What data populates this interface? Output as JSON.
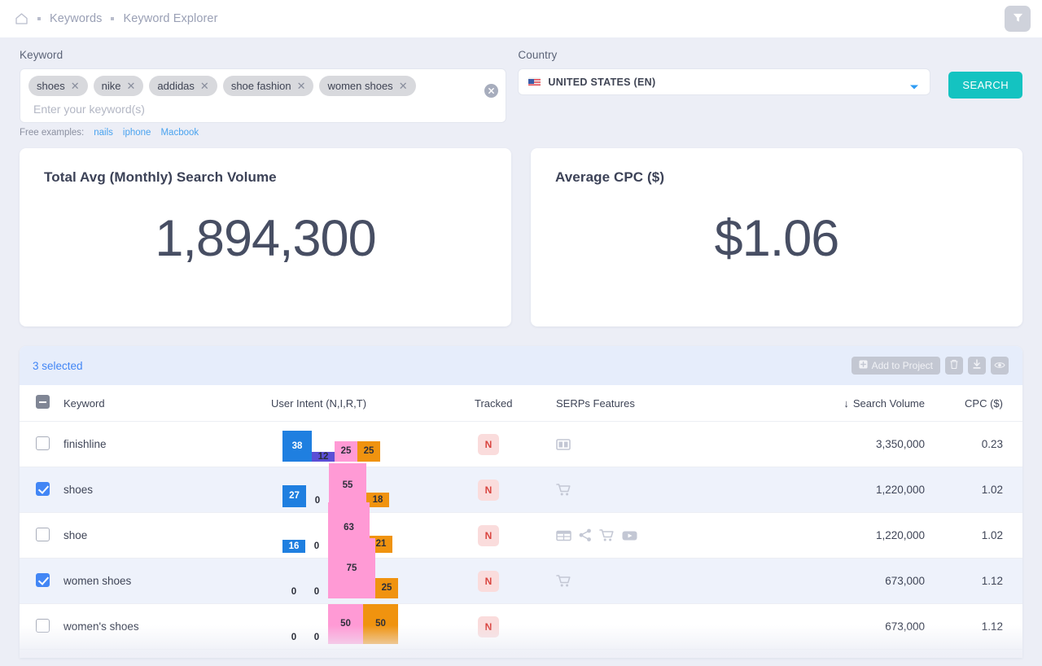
{
  "breadcrumb": {
    "home_icon": "home-icon",
    "items": [
      "Keywords",
      "Keyword Explorer"
    ]
  },
  "topbar": {
    "filter_icon": "filter-icon"
  },
  "search": {
    "keyword_label": "Keyword",
    "chips": [
      "shoes",
      "nike",
      "addidas",
      "shoe fashion",
      "women shoes"
    ],
    "placeholder": "Enter your keyword(s)",
    "clear_icon": "clear-circle-icon",
    "examples_label": "Free examples:",
    "examples": [
      "nails",
      "iphone",
      "Macbook"
    ],
    "country_label": "Country",
    "country_value": "UNITED STATES (EN)",
    "country_flag": "us-flag-icon",
    "caret_icon": "chevron-down-icon",
    "search_button": "SEARCH"
  },
  "cards": [
    {
      "title": "Total Avg (Monthly) Search Volume",
      "value": "1,894,300"
    },
    {
      "title": "Average CPC ($)",
      "value": "$1.06"
    }
  ],
  "table": {
    "selected_text": "3 selected",
    "add_to_project": "Add to Project",
    "add_icon": "plus-square-icon",
    "delete_icon": "trash-icon",
    "download_icon": "download-icon",
    "view_icon": "eye-icon",
    "headers": {
      "check": "select-all",
      "keyword": "Keyword",
      "intent": "User Intent (N,I,R,T)",
      "tracked": "Tracked",
      "serps": "SERPs Features",
      "volume": "Search Volume",
      "cpc": "CPC ($)",
      "sort_arrow": "↓"
    },
    "rows": [
      {
        "checked": false,
        "keyword": "finishline",
        "intent": {
          "N": 38,
          "I": 12,
          "R": 25,
          "T": 25
        },
        "tracked": "N",
        "serps": [
          "sitelinks-icon"
        ],
        "volume": "3,350,000",
        "cpc": "0.23"
      },
      {
        "checked": true,
        "keyword": "shoes",
        "intent": {
          "N": 27,
          "I": 0,
          "R": 55,
          "T": 18
        },
        "tracked": "N",
        "serps": [
          "shopping-cart-icon"
        ],
        "volume": "1,220,000",
        "cpc": "1.02"
      },
      {
        "checked": false,
        "keyword": "shoe",
        "intent": {
          "N": 16,
          "I": 0,
          "R": 63,
          "T": 21
        },
        "tracked": "N",
        "serps": [
          "table-icon",
          "share-icon",
          "shopping-cart-icon",
          "youtube-icon"
        ],
        "volume": "1,220,000",
        "cpc": "1.02"
      },
      {
        "checked": true,
        "keyword": "women shoes",
        "intent": {
          "N": 0,
          "I": 0,
          "R": 75,
          "T": 25
        },
        "tracked": "N",
        "serps": [
          "shopping-cart-icon"
        ],
        "volume": "673,000",
        "cpc": "1.12"
      },
      {
        "checked": false,
        "keyword": "women's shoes",
        "intent": {
          "N": 0,
          "I": 0,
          "R": 50,
          "T": 50
        },
        "tracked": "N",
        "serps": [],
        "volume": "673,000",
        "cpc": "1.12"
      }
    ]
  },
  "colors": {
    "intent_N": "#1f7fe0",
    "intent_I": "#5b4fd6",
    "intent_R": "#ff9ad5",
    "intent_T": "#f0930f",
    "accent_teal": "#14c3c1",
    "accent_blue": "#4286f5",
    "badge_red": "#d9443f",
    "badge_red_bg": "#fadcdc"
  }
}
